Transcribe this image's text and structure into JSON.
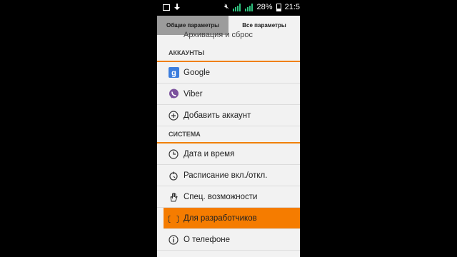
{
  "statusbar": {
    "battery": "28%",
    "time": "21:5"
  },
  "tabs": {
    "general": "Общие параметры",
    "all": "Все параметры"
  },
  "partial_item": "Архивация и сброс",
  "sections": {
    "accounts": "АККАУНТЫ",
    "system": "СИСТЕМА"
  },
  "accounts": [
    {
      "label": "Google",
      "icon": "google-icon"
    },
    {
      "label": "Viber",
      "icon": "viber-icon"
    },
    {
      "label": "Добавить аккаунт",
      "icon": "add-circle-icon"
    }
  ],
  "system": [
    {
      "label": "Дата и время",
      "icon": "clock-icon"
    },
    {
      "label": "Расписание вкл./откл.",
      "icon": "schedule-power-icon"
    },
    {
      "label": "Спец. возможности",
      "icon": "hand-icon"
    },
    {
      "label": "Для разработчиков",
      "icon": "braces-icon"
    },
    {
      "label": "О телефоне",
      "icon": "info-icon"
    }
  ],
  "colors": {
    "accent": "#f57c00",
    "section_line": "#f08000",
    "active_tab": "#9c9c9c"
  }
}
